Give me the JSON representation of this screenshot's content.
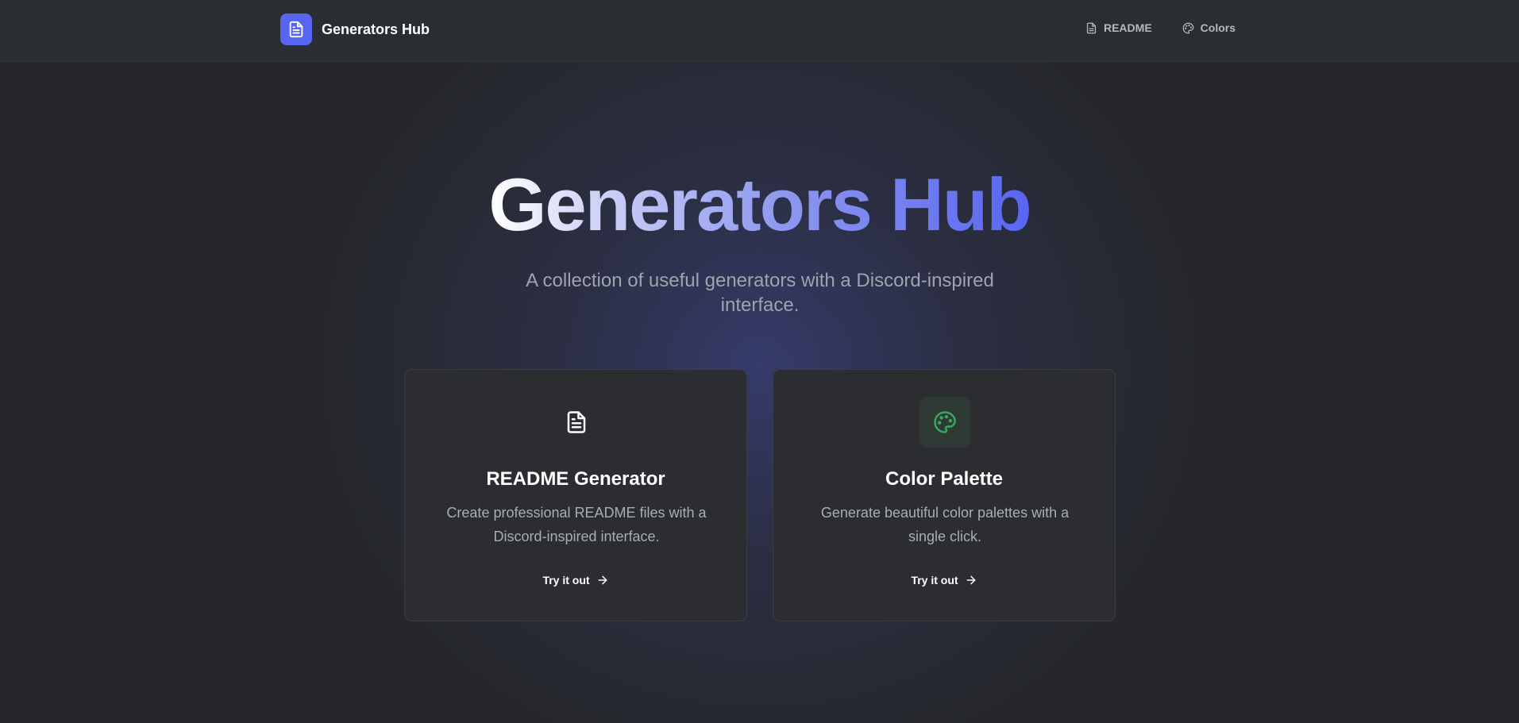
{
  "colors": {
    "accent": "#5865f2",
    "green": "#3ba55d",
    "background": "#25272b",
    "card": "#2b2d31"
  },
  "navbar": {
    "brand": "Generators Hub",
    "brand_icon": "document-icon",
    "links": [
      {
        "label": "README",
        "icon": "document-icon"
      },
      {
        "label": "Colors",
        "icon": "palette-icon"
      }
    ]
  },
  "hero": {
    "title": "Generators Hub",
    "subtitle": "A collection of useful generators with a Discord-inspired interface."
  },
  "cards": [
    {
      "title": "README Generator",
      "description": "Create professional README files with a Discord-inspired interface.",
      "link": "Try it out",
      "icon": "document-icon"
    },
    {
      "title": "Color Palette",
      "description": "Generate beautiful color palettes with a single click.",
      "link": "Try it out",
      "icon": "palette-icon"
    }
  ]
}
